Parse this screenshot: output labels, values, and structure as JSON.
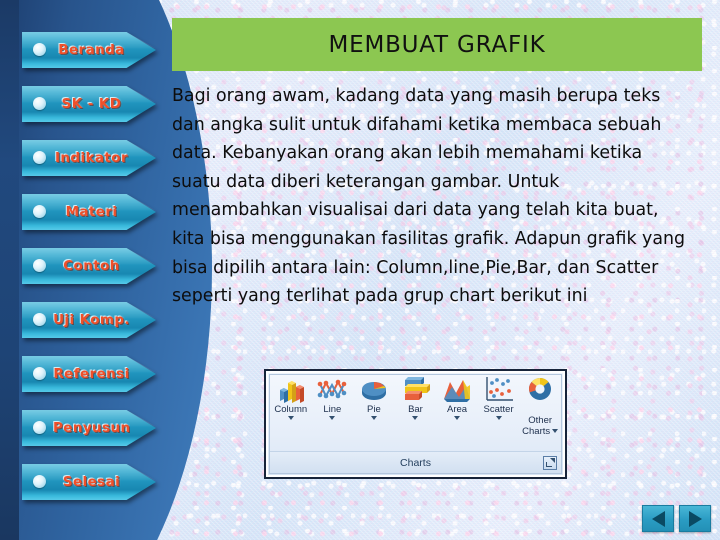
{
  "slide": {
    "title": "MEMBUAT GRAFIK",
    "body_text": "Bagi orang awam, kadang data yang masih berupa teks dan angka sulit untuk difahami ketika membaca sebuah data. Kebanyakan orang akan lebih memahami ketika suatu data diberi keterangan gambar. Untuk menambahkan visualisai dari data yang telah kita buat, kita bisa menggunakan fasilitas grafik. Adapun grafik yang bisa dipilih antara lain: Column,line,Pie,Bar, dan Scatter seperti yang terlihat pada grup chart berikut ini",
    "title_banner_color": "#8cc751",
    "panel_color": "#2f639f"
  },
  "sidebar": {
    "items": [
      {
        "label": "Beranda"
      },
      {
        "label": "SK - KD"
      },
      {
        "label": "Indikator"
      },
      {
        "label": "Materi"
      },
      {
        "label": "Contoh"
      },
      {
        "label": "Uji  Komp."
      },
      {
        "label": "Referensi"
      },
      {
        "label": "Penyusun"
      },
      {
        "label": "Selesai"
      }
    ],
    "label_color": "#f0502a",
    "button_color": "#1f93bc"
  },
  "ribbon": {
    "group_label": "Charts",
    "dialog_launcher_name": "charts-dialog-launcher",
    "items": [
      {
        "label": "Column",
        "icon": "column-chart-icon"
      },
      {
        "label": "Line",
        "icon": "line-chart-icon"
      },
      {
        "label": "Pie",
        "icon": "pie-chart-icon"
      },
      {
        "label": "Bar",
        "icon": "bar-chart-icon"
      },
      {
        "label": "Area",
        "icon": "area-chart-icon"
      },
      {
        "label": "Scatter",
        "icon": "scatter-chart-icon"
      },
      {
        "label": "Other\nCharts",
        "icon": "other-charts-icon"
      }
    ]
  },
  "navigation": {
    "prev_label": "",
    "next_label": ""
  }
}
